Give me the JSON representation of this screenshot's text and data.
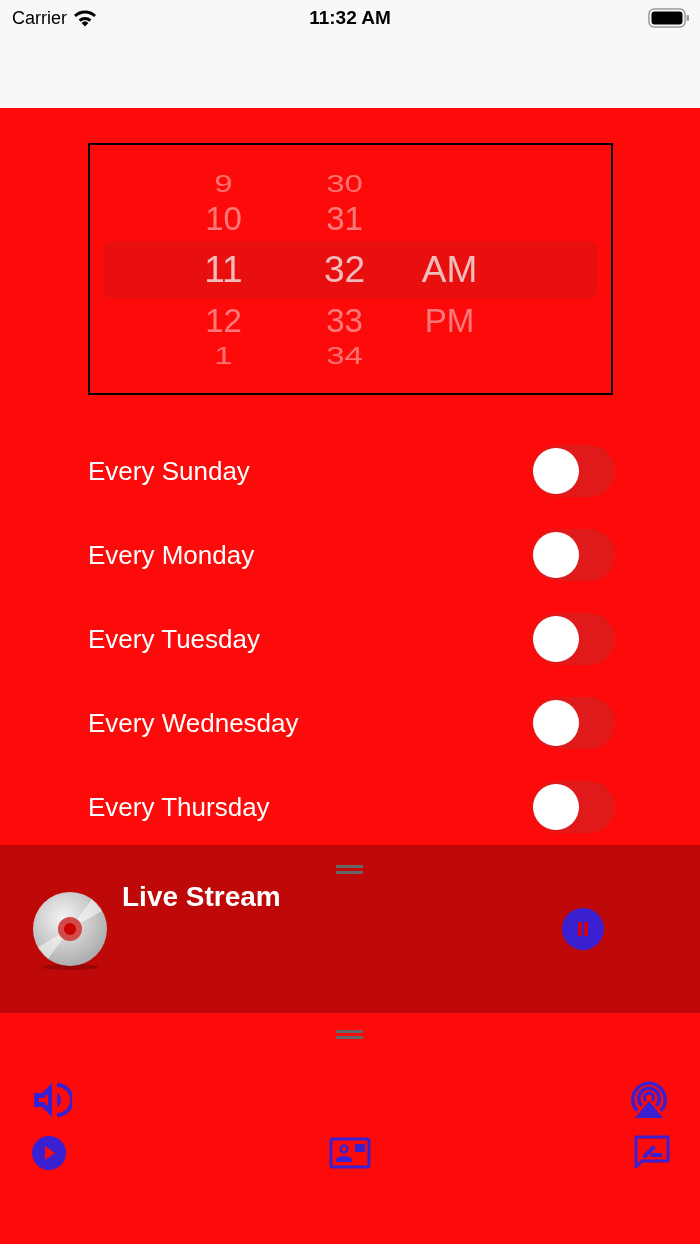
{
  "status_bar": {
    "carrier": "Carrier",
    "time": "11:32 AM"
  },
  "picker": {
    "columns": [
      {
        "items": [
          {
            "text": "9",
            "selected": false
          },
          {
            "text": "10",
            "selected": false
          },
          {
            "text": "11",
            "selected": true
          },
          {
            "text": "12",
            "selected": false
          },
          {
            "text": "1",
            "selected": false
          }
        ]
      },
      {
        "items": [
          {
            "text": "30",
            "selected": false
          },
          {
            "text": "31",
            "selected": false
          },
          {
            "text": "32",
            "selected": true
          },
          {
            "text": "33",
            "selected": false
          },
          {
            "text": "34",
            "selected": false
          }
        ]
      },
      {
        "items": [
          {
            "text": "AM",
            "selected": true
          },
          {
            "text": "PM",
            "selected": false
          }
        ]
      }
    ]
  },
  "repeat_days": [
    {
      "label": "Every Sunday",
      "on": false
    },
    {
      "label": "Every Monday",
      "on": false
    },
    {
      "label": "Every Tuesday",
      "on": false
    },
    {
      "label": "Every Wednesday",
      "on": false
    },
    {
      "label": "Every Thursday",
      "on": false
    }
  ],
  "player": {
    "title": "Live Stream",
    "playing": true
  }
}
